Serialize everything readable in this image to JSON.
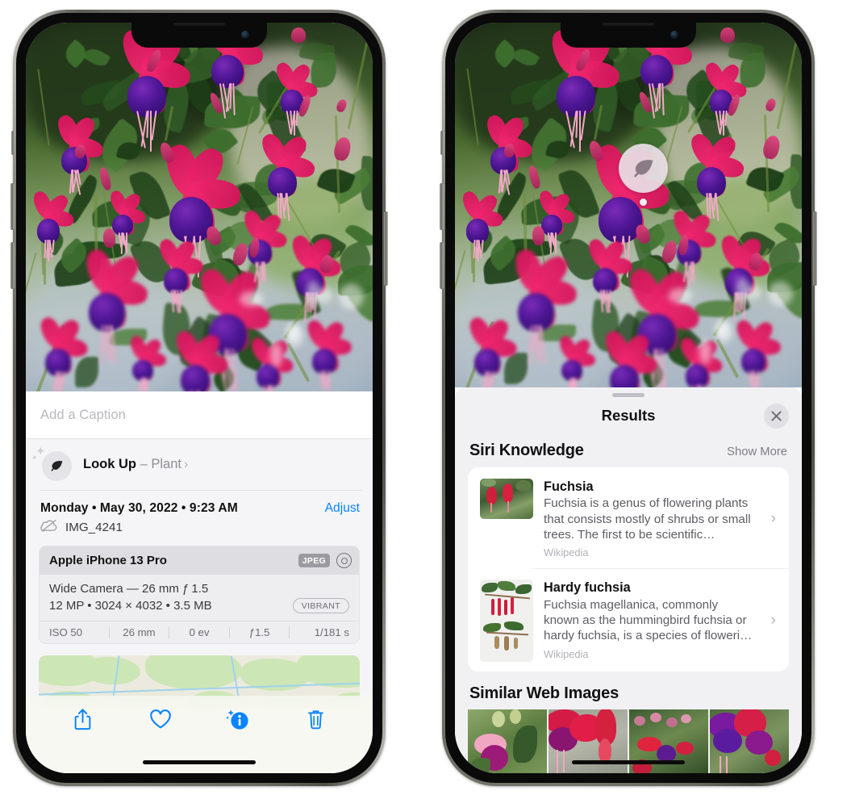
{
  "left_phone": {
    "name": "photos-detail-view",
    "caption_placeholder": "Add a Caption",
    "lookup": {
      "icon": "leaf-icon",
      "label": "Look Up",
      "dash": " – ",
      "subject": "Plant",
      "chevron": "›"
    },
    "datetime": "Monday • May 30, 2022 • 9:23 AM",
    "adjust_label": "Adjust",
    "filename": "IMG_4241",
    "filename_icon": "icloud-slash-icon",
    "camera": {
      "model": "Apple iPhone 13 Pro",
      "format_tag": "JPEG",
      "lens_icon": "lens-icon",
      "lens_line": "Wide Camera — 26 mm ƒ 1.5",
      "spec_line": "12 MP  •  3024 × 4032  •  3.5 MB",
      "style_tag": "VIBRANT",
      "exif": [
        "ISO 50",
        "26 mm",
        "0 ev",
        "ƒ1.5",
        "1/181 s"
      ]
    },
    "toolbar": [
      {
        "name": "share-button",
        "icon": "share-icon"
      },
      {
        "name": "favorite-button",
        "icon": "heart-icon"
      },
      {
        "name": "info-button",
        "icon": "info-sparkle-icon"
      },
      {
        "name": "delete-button",
        "icon": "trash-icon"
      }
    ]
  },
  "right_phone": {
    "name": "visual-lookup-results",
    "badge_icon": "leaf-badge-icon",
    "sheet": {
      "title": "Results",
      "close_icon": "close-icon",
      "siri_knowledge": {
        "title": "Siri Knowledge",
        "show_more": "Show More",
        "items": [
          {
            "title": "Fuchsia",
            "description": "Fuchsia is a genus of flowering plants that consists mostly of shrubs or small trees. The first to be scientific…",
            "source": "Wikipedia",
            "chevron": "›"
          },
          {
            "title": "Hardy fuchsia",
            "description": "Fuchsia magellanica, commonly known as the hummingbird fuchsia or hardy fuchsia, is a species of floweri…",
            "source": "Wikipedia",
            "chevron": "›"
          }
        ]
      },
      "similar_web_images": {
        "title": "Similar Web Images",
        "count": 4
      }
    }
  },
  "colors": {
    "accent_blue": "#0a84ff",
    "sheet_bg": "#f1f1f4",
    "card_bg": "#ffffff",
    "secondary_text": "#8e8e93"
  }
}
